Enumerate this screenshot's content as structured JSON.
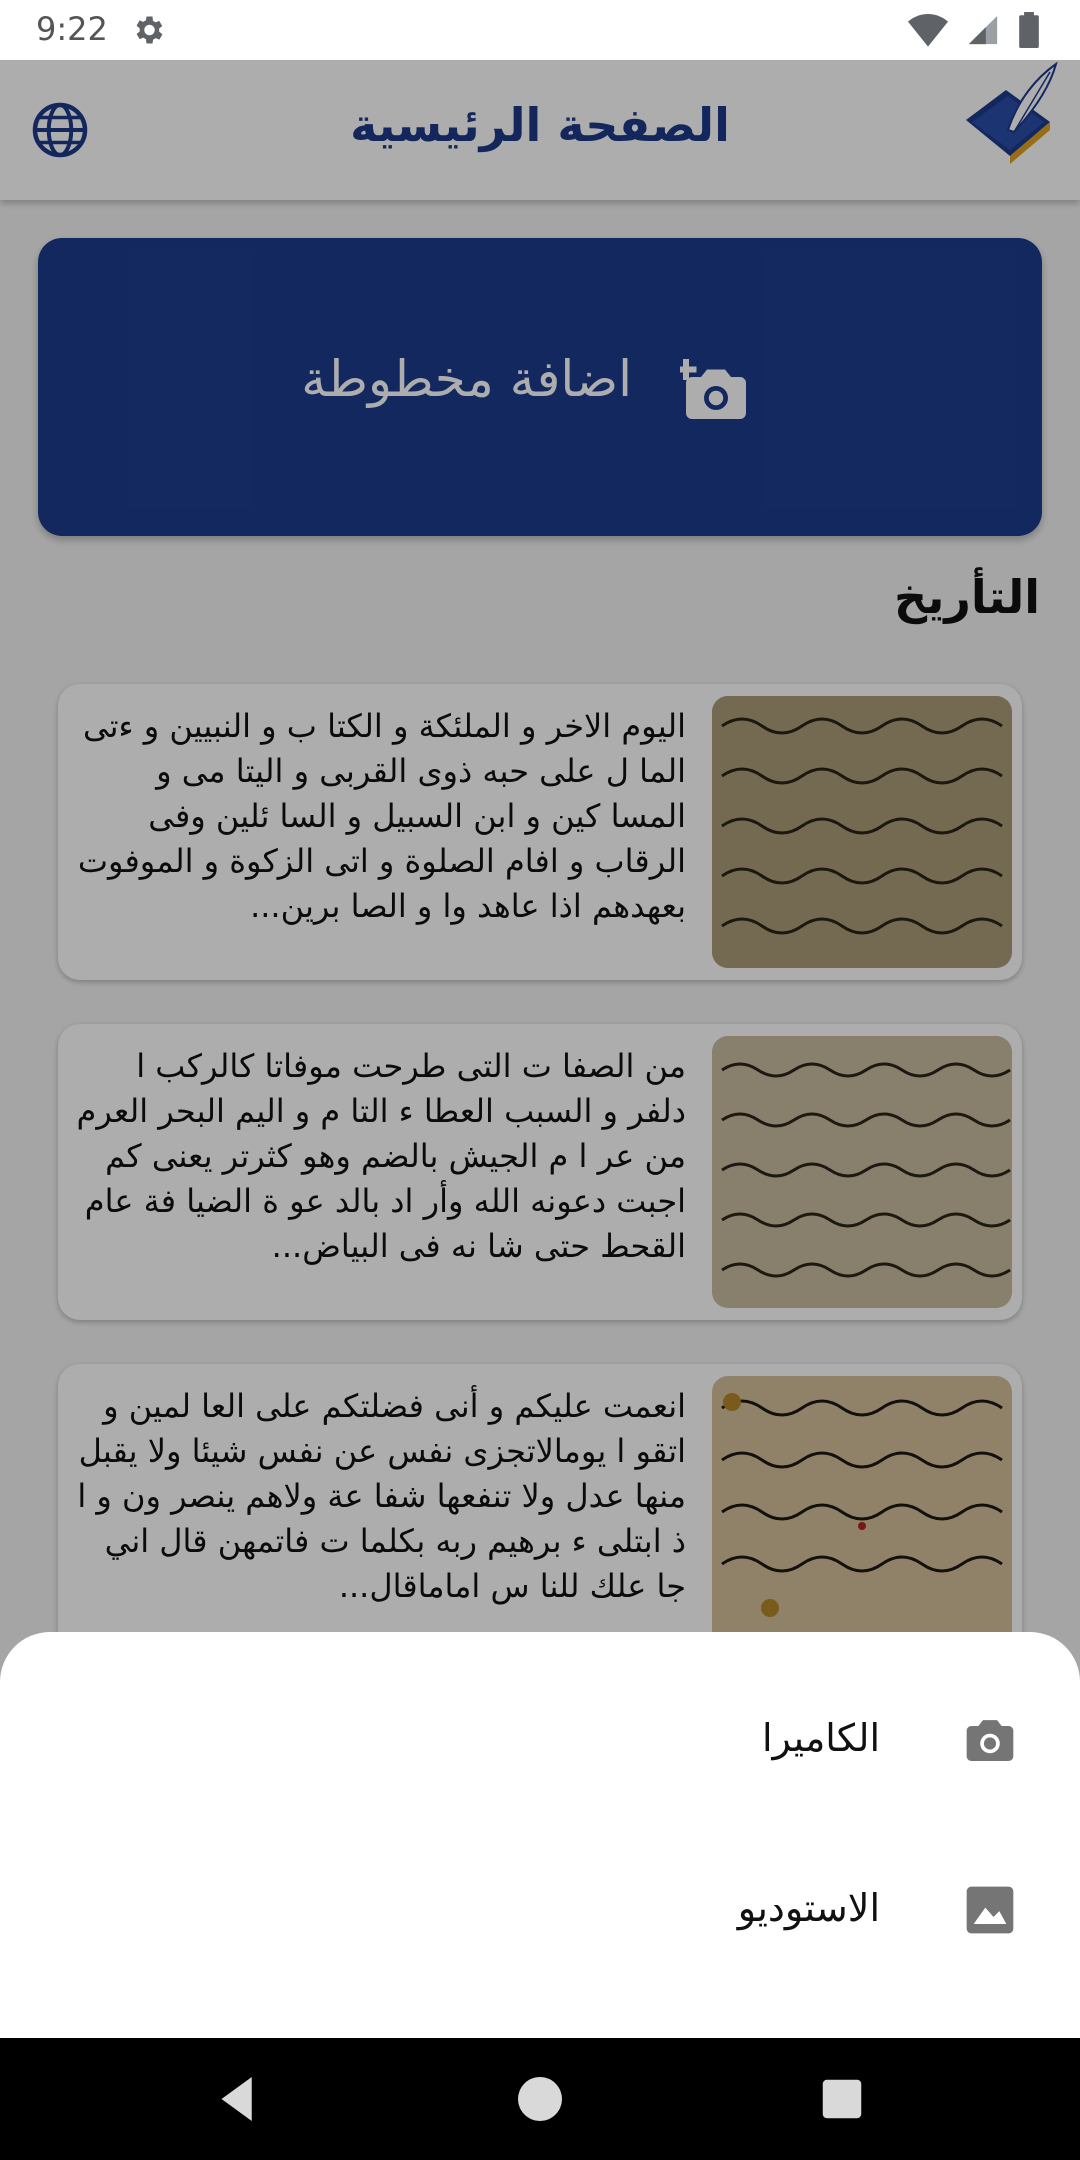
{
  "status_bar": {
    "time": "9:22"
  },
  "app_bar": {
    "title": "الصفحة الرئيسية"
  },
  "add_manuscript": {
    "label": "اضافة مخطوطة"
  },
  "history": {
    "title": "التأريخ",
    "items": [
      {
        "text": "اليوم الاخر و الملئكة و الكتا ب و النبيين و ءتى الما ل على حبه ذوى القربى و اليتا مى و المسا كين و ابن السبيل و السا ئلين وفى الرقاب و افام الصلوة و اتى الزكوة و الموفوت بعهدهم اذا عاهد وا و الصا برين..."
      },
      {
        "text": "من الصفا ت التى طرحت موفاتا كالركب ا دلفر و السبب العطا ء التا م و اليم البحر العرم من عر ا م الجيش بالضم وهو كثرتر يعنى كم اجبت دعونه الله وأر اد بالد عو ة الضيا فة عام القحط حتى شا نه فى البياض..."
      },
      {
        "text": "انعمت عليكم و أنى فضلتكم على العا لمين و اتقو ا يومالاتجزى نفس عن نفس شيئا ولا يقبل منها عدل ولا تنفعها شفا عة ولاهم ينصر ون و ا ذ ابتلى ء برهيم ربه بكلما ت فاتمهن قال اني جا علك للنا س اماماقال..."
      }
    ]
  },
  "bottom_sheet": {
    "options": [
      {
        "label": "الكاميرا",
        "icon": "camera-icon"
      },
      {
        "label": "الاستوديو",
        "icon": "image-icon"
      }
    ]
  },
  "colors": {
    "primary": "#1e3c8e",
    "scrim": "rgba(0,0,0,0.32)"
  }
}
